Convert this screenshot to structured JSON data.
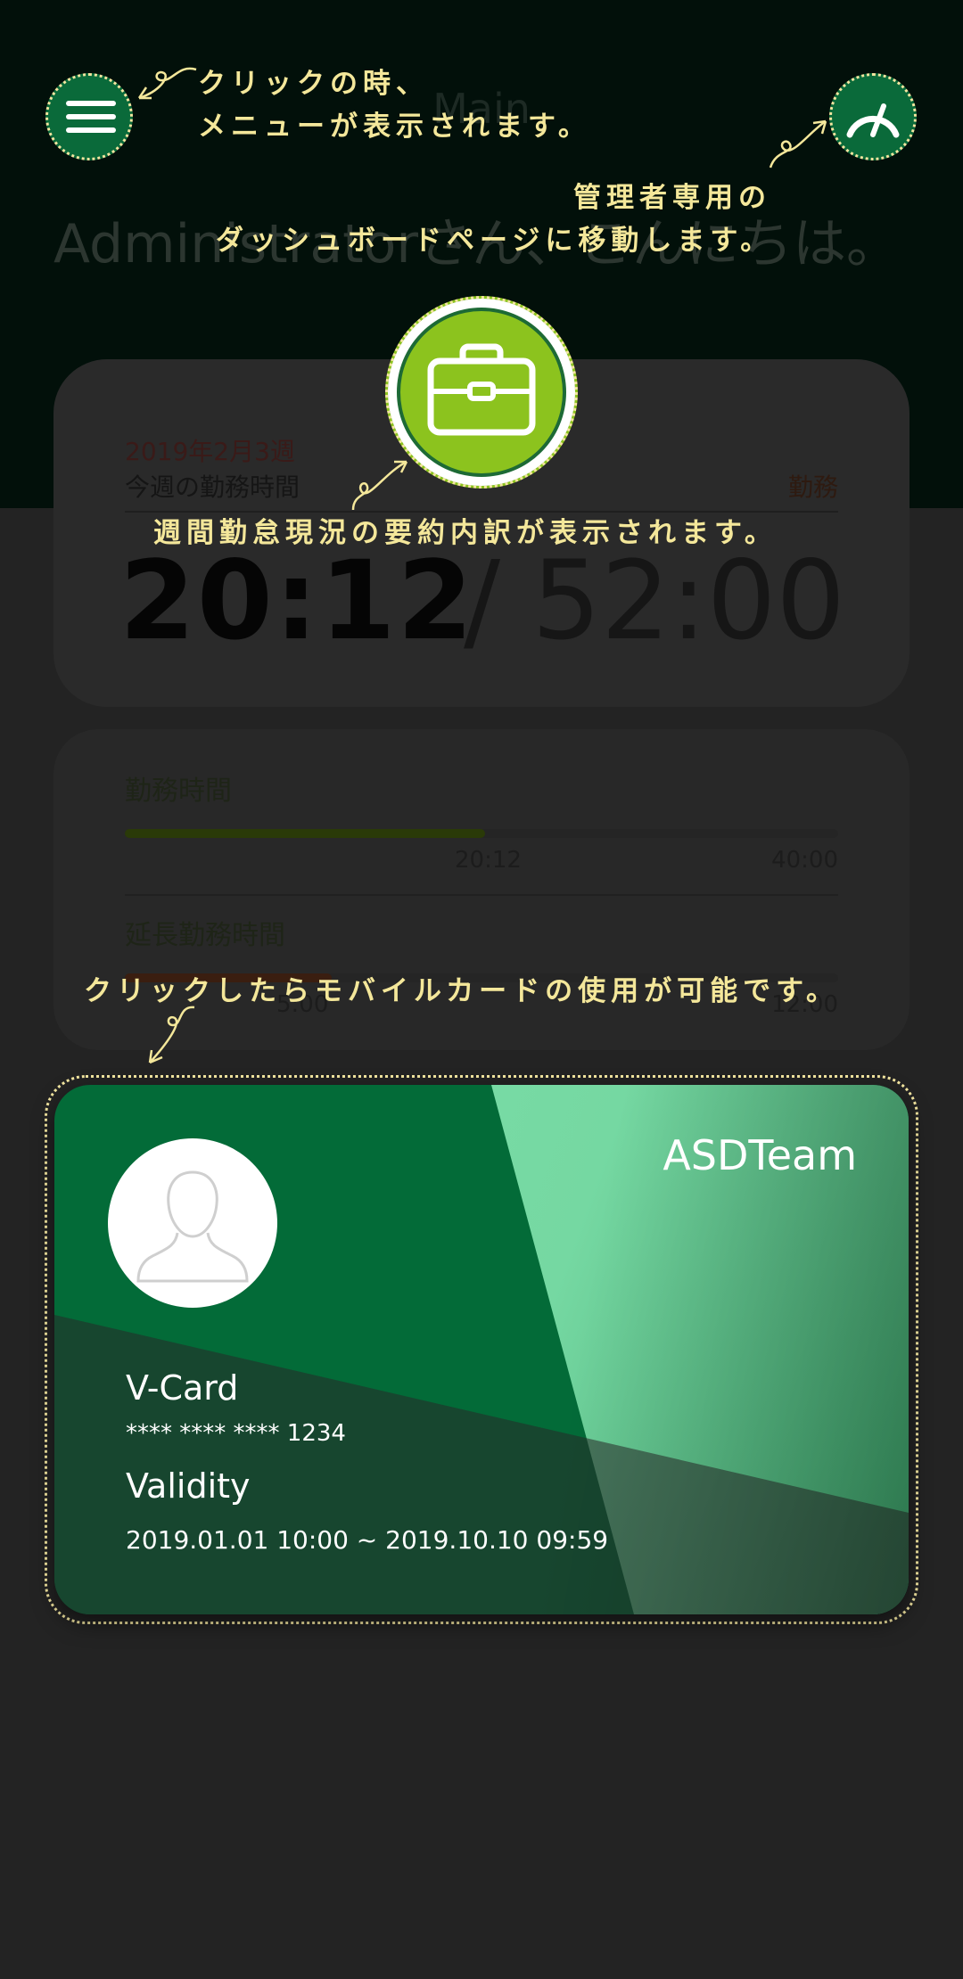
{
  "header": {
    "title": "Main",
    "greeting": "Administratorさん、こんにちは。"
  },
  "summary": {
    "week_label": "2019年2月3週",
    "week_sub": "今週の勤務時間",
    "kind": "勤務",
    "worked": "20:12",
    "separator": "/",
    "target": "52:00"
  },
  "bars": [
    {
      "label": "勤務時間",
      "current": "20:12",
      "max": "40:00",
      "progress": 0.505,
      "color": "#2a3a08"
    },
    {
      "label": "延長勤務時間",
      "current": "5:00",
      "max": "12:00",
      "progress": 0.29,
      "color": "#3a1e10"
    }
  ],
  "vcard": {
    "brand": "ASDTeam",
    "title": "V-Card",
    "number": "**** **** **** 1234",
    "validity_label": "Validity",
    "validity_range": "2019.01.01 10:00 ~ 2019.10.10 09:59"
  },
  "annotations": {
    "menu": [
      "クリックの時、",
      "メニューが表示されます。"
    ],
    "dashboard": [
      "管理者専用の",
      "ダッシュボードページに移動します。"
    ],
    "summary": "週間勤怠現況の要約内訳が表示されます。",
    "card": "クリックしたらモバイルカードの使用が可能です。"
  },
  "icons": {
    "menu": "hamburger-menu-icon",
    "dashboard": "speedometer-icon",
    "briefcase": "briefcase-icon",
    "avatar": "user-silhouette-icon"
  },
  "colors": {
    "accent_green": "#0a6a3a",
    "lime": "#8cc31e",
    "annotation": "#f4e79a"
  }
}
